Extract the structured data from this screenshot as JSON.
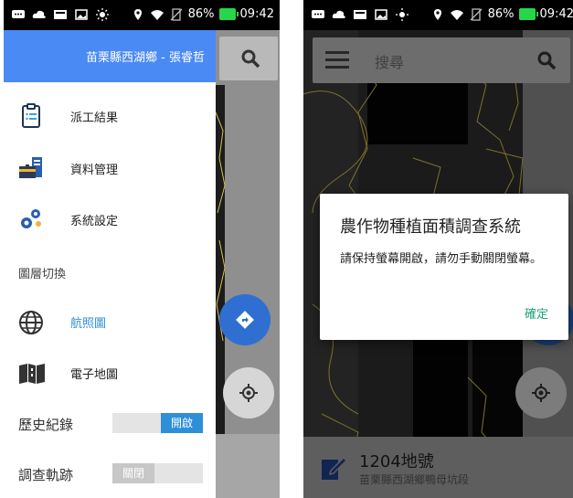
{
  "status_bar": {
    "battery": "86%",
    "time": "09:42",
    "icons": [
      "chat-icon",
      "cloud-icon",
      "mail-icon",
      "image-icon",
      "brightness-icon",
      "location-icon",
      "wifi-icon",
      "no-sim-icon",
      "battery-charging-icon"
    ]
  },
  "drawer": {
    "header_user": "苗栗縣西湖鄉 - 張睿哲",
    "menu": [
      {
        "icon": "clipboard-icon",
        "label": "派工結果"
      },
      {
        "icon": "database-icon",
        "label": "資料管理"
      },
      {
        "icon": "gears-icon",
        "label": "系統設定"
      }
    ],
    "layer_section_title": "圖層切換",
    "layers": [
      {
        "icon": "globe-icon",
        "label": "航照圖",
        "active": true
      },
      {
        "icon": "map-icon",
        "label": "電子地圖",
        "active": false
      }
    ],
    "toggles": [
      {
        "label": "歷史紀錄",
        "state": "開啟",
        "on": true
      },
      {
        "label": "調查軌跡",
        "state": "關閉",
        "on": false
      }
    ]
  },
  "search": {
    "placeholder": "搜尋"
  },
  "dialog": {
    "title": "農作物種植面積調查系統",
    "message": "請保持螢幕開啟，請勿手動關閉螢幕。",
    "ok_label": "確定"
  },
  "parcel": {
    "number": "1204地號",
    "location": "苗栗縣西湖鄉鴨母坑段"
  },
  "colors": {
    "header_blue": "#4a8af4",
    "active_layer_blue": "#2e8fd8",
    "fab_blue": "#2f6fd1",
    "dialog_accent": "#1e9e7a",
    "parcel_boundary": "#d9c24a"
  }
}
